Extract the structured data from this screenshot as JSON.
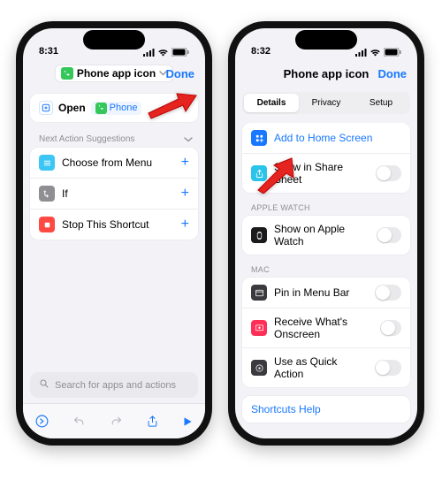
{
  "left": {
    "time": "8:31",
    "title": "Phone app icon",
    "done": "Done",
    "open_card": {
      "open": "Open",
      "app": "Phone"
    },
    "suggestion_label": "Next Action Suggestions",
    "suggestions": [
      {
        "label": "Choose from Menu"
      },
      {
        "label": "If"
      },
      {
        "label": "Stop This Shortcut"
      }
    ],
    "search_placeholder": "Search for apps and actions"
  },
  "right": {
    "time": "8:32",
    "title": "Phone app icon",
    "done": "Done",
    "tabs": [
      "Details",
      "Privacy",
      "Setup"
    ],
    "active_tab": 0,
    "groups": {
      "main": [
        {
          "label": "Add to Home Screen",
          "link": true,
          "icon": "home"
        },
        {
          "label": "Show in Share Sheet",
          "toggle": true,
          "icon": "share"
        }
      ],
      "watch_label": "APPLE WATCH",
      "watch": [
        {
          "label": "Show on Apple Watch",
          "toggle": true,
          "icon": "watch"
        }
      ],
      "mac_label": "MAC",
      "mac": [
        {
          "label": "Pin in Menu Bar",
          "toggle": true,
          "icon": "menubar"
        },
        {
          "label": "Receive What's Onscreen",
          "toggle": true,
          "icon": "onscreen"
        },
        {
          "label": "Use as Quick Action",
          "toggle": true,
          "icon": "quick"
        }
      ],
      "help": "Shortcuts Help"
    }
  }
}
